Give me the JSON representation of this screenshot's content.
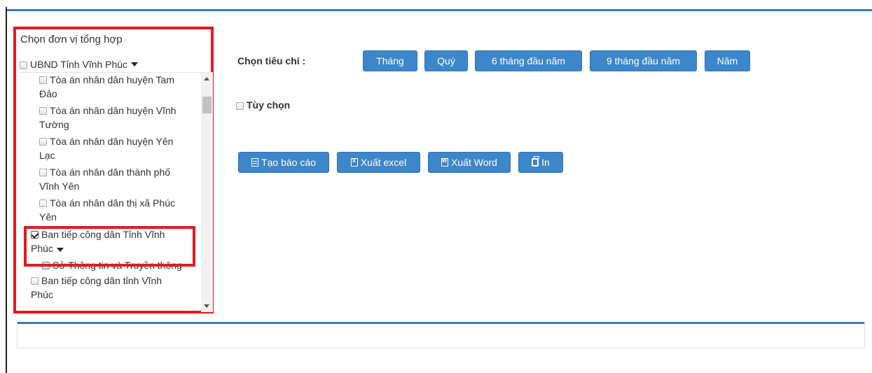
{
  "left_panel": {
    "title": "Chọn đơn vị tổng hợp",
    "root_label": "UBND Tỉnh Vĩnh Phúc",
    "items": [
      {
        "label": "Tòa án nhân dân huyện Tam Đảo",
        "checked": false
      },
      {
        "label": "Tòa án nhân dân huyện Vĩnh Tường",
        "checked": false
      },
      {
        "label": "Tòa án nhân dân huyện Yên Lạc",
        "checked": false
      },
      {
        "label": "Tòa án nhân dân thành phố Vĩnh Yên",
        "checked": false
      },
      {
        "label": "Tòa án nhân dân thị xã Phúc Yên",
        "checked": false
      },
      {
        "label": "Ban tiếp công dân Tỉnh Vĩnh Phúc",
        "checked": true
      },
      {
        "label": "Sở Thông tin và Truyền thông",
        "checked": false
      },
      {
        "label": "Ban tiếp công dân tỉnh Vĩnh Phúc",
        "checked": false
      }
    ],
    "lines": {
      "i0a": "Tòa án nhân dân huyện Tam",
      "i0b": "Đảo",
      "i1a": "Tòa án nhân dân huyện Vĩnh",
      "i1b": "Tường",
      "i2a": "Tòa án nhân dân huyện Yên",
      "i2b": "Lạc",
      "i3a": "Tòa án nhân dân thành phố",
      "i3b": "Vĩnh Yên",
      "i4a": "Tòa án nhân dân thị xã Phúc",
      "i4b": "Yên",
      "i5a": "Ban tiếp công dân Tỉnh Vĩnh",
      "i5b": "Phúc",
      "i6a": "Sở Thông tin và Truyền thông",
      "i7a": "Ban tiếp công dân tỉnh Vĩnh",
      "i7b": "Phúc"
    }
  },
  "criteria": {
    "label": "Chọn tiêu chí :",
    "buttons": [
      "Tháng",
      "Quý",
      "6 tháng đầu năm",
      "9 tháng đầu năm",
      "Năm"
    ],
    "custom_label": "Tùy chọn"
  },
  "actions": {
    "create_report": "Tạo báo cáo",
    "export_excel": "Xuất excel",
    "export_word": "Xuất Word",
    "print": "In"
  },
  "colors": {
    "accent": "#3d86c9",
    "highlight": "#e01b22",
    "frame": "#3c7ab8"
  }
}
